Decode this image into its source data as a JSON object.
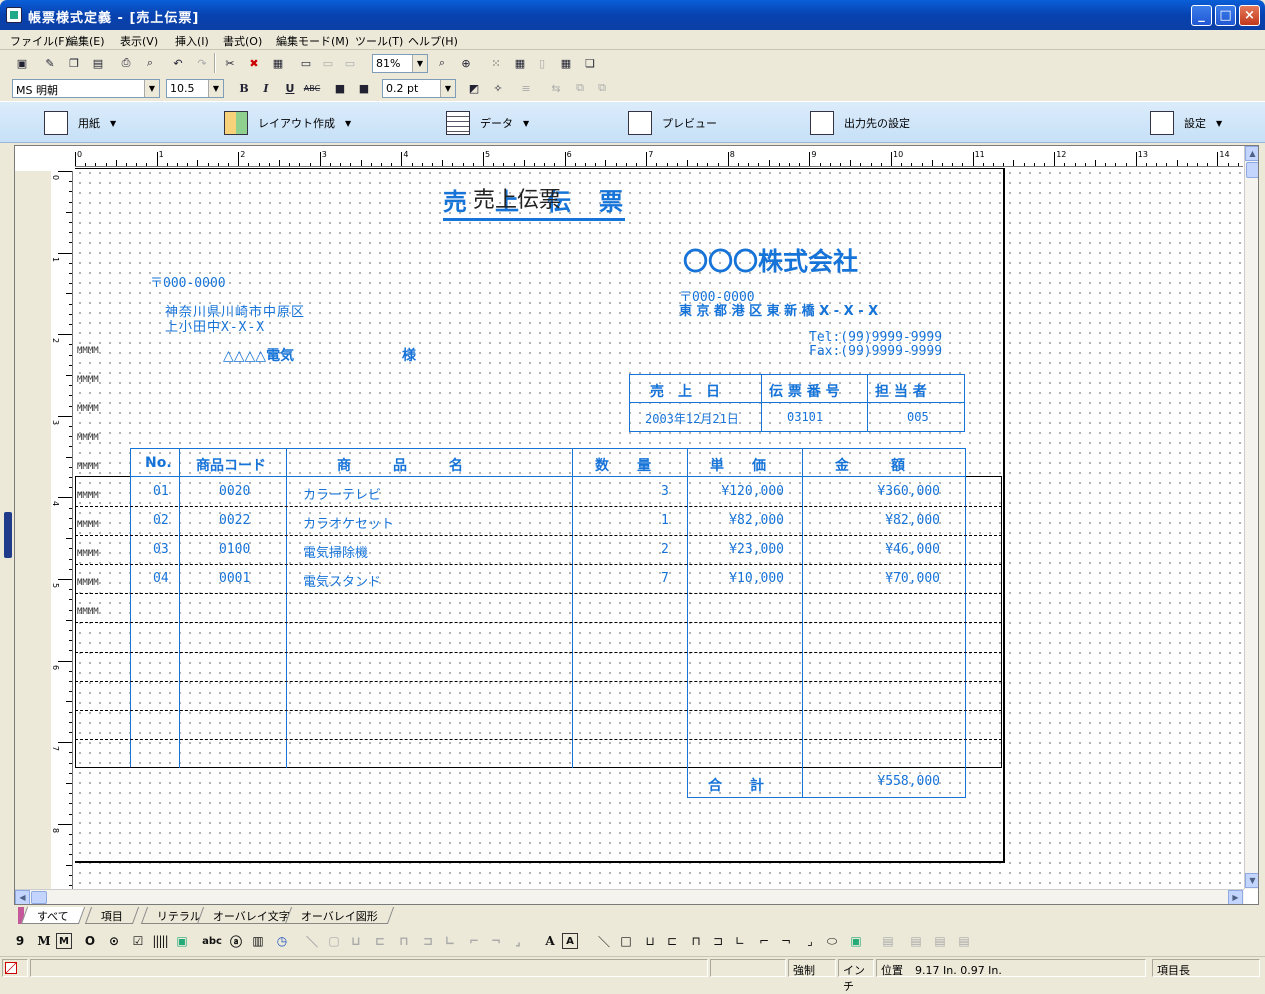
{
  "window": {
    "title": "帳票様式定義 - [売上伝票]"
  },
  "menu": [
    "ファイル(F)",
    "編集(E)",
    "表示(V)",
    "挿入(I)",
    "書式(O)",
    "編集モード(M)",
    "ツール(T)",
    "ヘルプ(H)"
  ],
  "toolbar": {
    "zoom": "81%",
    "font": "MS 明朝",
    "size": "10.5",
    "line": "0.2 pt"
  },
  "bigbar": {
    "paper": "用紙",
    "layout": "レイアウト作成",
    "data": "データ",
    "preview": "プレビュー",
    "output": "出力先の設定",
    "settings": "設定"
  },
  "ruler": {
    "h": [
      "0",
      "1",
      "2",
      "3",
      "4",
      "5",
      "6",
      "7",
      "8",
      "9",
      "10",
      "11",
      "12",
      "13",
      "14"
    ],
    "v": [
      "0",
      "1",
      "2",
      "3",
      "4",
      "5",
      "6",
      "7",
      "8"
    ]
  },
  "form": {
    "title": "売　上　伝　票",
    "title_ghost": "売上伝票",
    "company": "〇〇〇株式会社",
    "postal_left": "〒000-0000",
    "addr1": "神奈川県川崎市中原区",
    "addr2": "上小田中X-X-X",
    "customer": "△△△△電気",
    "honorific": "様",
    "postal_right": "〒000-0000",
    "company_addr": "東 京 都 港 区 東 新 橋 X - X - X",
    "tel": "Tel:(99)9999-9999",
    "fax": "Fax:(99)9999-9999",
    "info_headers": [
      "売　上　日",
      "伝 票 番 号",
      "担 当 者"
    ],
    "info_values": [
      "2003年12月21日",
      "03101",
      "005"
    ],
    "table_headers": [
      "No.",
      "商品コード",
      "商　　　品　　　名",
      "数　　量",
      "単　　価",
      "金　　　額"
    ],
    "rows": [
      [
        "01",
        "0020",
        "カラーテレビ",
        "3",
        "¥120,000",
        "¥360,000"
      ],
      [
        "02",
        "0022",
        "カラオケセット",
        "1",
        "¥82,000",
        "¥82,000"
      ],
      [
        "03",
        "0100",
        "電気掃除機",
        "2",
        "¥23,000",
        "¥46,000"
      ],
      [
        "04",
        "0001",
        "電気スタンド",
        "7",
        "¥10,000",
        "¥70,000"
      ]
    ],
    "total_label": "合　　計",
    "total_value": "¥558,000",
    "mmmm": "MMMM"
  },
  "tabs": [
    "すべて",
    "項目",
    "リテラル",
    "オーバレイ文字",
    "オーバレイ図形"
  ],
  "status": {
    "mode": "強制",
    "unit": "インチ",
    "pos_label": "位置",
    "pos": "9.17 In.  0.97 In.",
    "item": "項目長"
  }
}
